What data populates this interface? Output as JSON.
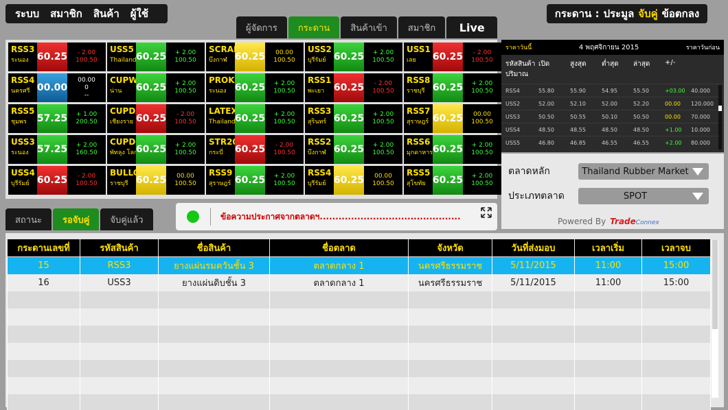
{
  "menu": [
    "ระบบ",
    "สมาชิก",
    "สินค้า",
    "ผู้ใช้"
  ],
  "tabs": [
    {
      "label": "ผู้จัดการ",
      "state": "normal"
    },
    {
      "label": "กระดาน",
      "state": "active"
    },
    {
      "label": "สินค้าเข้า",
      "state": "normal"
    },
    {
      "label": "สมาชิก",
      "state": "normal"
    },
    {
      "label": "Live",
      "state": "live"
    }
  ],
  "mode": {
    "board": "กระดาน :",
    "auction": "ประมูล",
    "match": "จับคู่",
    "contract": "ข้อตกลง"
  },
  "board": [
    {
      "code": "RSS3",
      "prov": "ระนอง",
      "price": "60.25",
      "c1": "- 2.00",
      "c2": "100.50",
      "trend": "dn"
    },
    {
      "code": "USS5",
      "prov": "Thailand",
      "price": "60.25",
      "c1": "+ 2.00",
      "c2": "100.50",
      "trend": "up"
    },
    {
      "code": "SCRAP",
      "prov": "บึงกาฬ",
      "price": "60.25",
      "c1": "00.00",
      "c2": "100.50",
      "trend": "eq"
    },
    {
      "code": "USS2",
      "prov": "บุรีรัมย์",
      "price": "60.25",
      "c1": "+ 2.00",
      "c2": "100.50",
      "trend": "up"
    },
    {
      "code": "USS1",
      "prov": "เลย",
      "price": "60.25",
      "c1": "- 2.00",
      "c2": "100.50",
      "trend": "dn"
    },
    {
      "code": "RSS4",
      "prov": "นครศรี",
      "price": "00.00",
      "c1": "00.00",
      "c2": "0",
      "c3": "--",
      "trend": "nt"
    },
    {
      "code": "CUPWET",
      "prov": "น่าน",
      "price": "60.25",
      "c1": "+ 2.00",
      "c2": "100.50",
      "trend": "up"
    },
    {
      "code": "PROK",
      "prov": "ระนอง",
      "price": "60.25",
      "c1": "+ 2.00",
      "c2": "100.50",
      "trend": "up"
    },
    {
      "code": "RSS1",
      "prov": "พะเยา",
      "price": "60.25",
      "c1": "- 2.00",
      "c2": "100.50",
      "trend": "dn"
    },
    {
      "code": "RSS8",
      "prov": "ราชบุรี",
      "price": "60.25",
      "c1": "+ 2.00",
      "c2": "100.50",
      "trend": "up"
    },
    {
      "code": "RSS5",
      "prov": "ชุมพร",
      "price": "57.25",
      "c1": "+ 1.00",
      "c2": "200.50",
      "trend": "up"
    },
    {
      "code": "CUPDAMP",
      "prov": "เชียงราย",
      "price": "60.25",
      "c1": "- 2.00",
      "c2": "100.50",
      "trend": "dn"
    },
    {
      "code": "LATEX",
      "prov": "Thailand",
      "price": "60.25",
      "c1": "+ 2.00",
      "c2": "100.50",
      "trend": "up"
    },
    {
      "code": "RSS3",
      "prov": "สุรินทร์",
      "price": "60.25",
      "c1": "+ 2.00",
      "c2": "100.50",
      "trend": "up"
    },
    {
      "code": "RSS7",
      "prov": "สุราษฎร์",
      "price": "60.25",
      "c1": "00.00",
      "c2": "100.50",
      "trend": "eq"
    },
    {
      "code": "USS3",
      "prov": "ระนอง",
      "price": "57.25",
      "c1": "+ 2.00",
      "c2": "160.50",
      "trend": "up"
    },
    {
      "code": "CUPDRY",
      "prov": "พัทลุง โลก",
      "price": "60.25",
      "c1": "+ 2.00",
      "c2": "100.50",
      "trend": "up"
    },
    {
      "code": "STR20",
      "prov": "กระบี่",
      "price": "60.25",
      "c1": "- 2.00",
      "c2": "100.50",
      "trend": "dn"
    },
    {
      "code": "RSS2",
      "prov": "บึงกาฬ",
      "price": "60.25",
      "c1": "+ 2.00",
      "c2": "100.50",
      "trend": "up"
    },
    {
      "code": "RSS6",
      "prov": "มุกดาหาร",
      "price": "60.25",
      "c1": "+ 2.00",
      "c2": "100.50",
      "trend": "up"
    },
    {
      "code": "USS4",
      "prov": "บุรีรัมย์",
      "price": "60.25",
      "c1": "- 2.00",
      "c2": "100.50",
      "trend": "dn"
    },
    {
      "code": "BULLOCK",
      "prov": "ราชบุรี",
      "price": "60.25",
      "c1": "00.00",
      "c2": "100.50",
      "trend": "eq"
    },
    {
      "code": "RSS9",
      "prov": "สุราษฎร์",
      "price": "60.25",
      "c1": "+ 2.00",
      "c2": "100.50",
      "trend": "up"
    },
    {
      "code": "RSS4",
      "prov": "บุรีรัมย์",
      "price": "60.25",
      "c1": "00.00",
      "c2": "100.50",
      "trend": "eq"
    },
    {
      "code": "RSS5",
      "prov": "สุโขทัย",
      "price": "60.25",
      "c1": "+ 2.00",
      "c2": "100.50",
      "trend": "up"
    }
  ],
  "prices": {
    "today_label": "ราคาวันนี้",
    "date": "4 พฤศจิกายน 2015",
    "prev_label": "ราคาวันก่อน",
    "cols": [
      "รหัสสินค้า",
      "เปิด",
      "สูงสุด",
      "ต่ำสุด",
      "ล่าสุด",
      "+/-",
      "ปริมาณ"
    ],
    "rows": [
      {
        "code": "RSS4",
        "open": "55.80",
        "high": "55.90",
        "low": "54.95",
        "last": "55.50",
        "chg": "+03.00",
        "vol": "40.000",
        "trend": "up"
      },
      {
        "code": "USS2",
        "open": "52.00",
        "high": "52.10",
        "low": "52.00",
        "last": "52.20",
        "chg": "00.00",
        "vol": "120.000",
        "trend": "eq"
      },
      {
        "code": "USS3",
        "open": "50.50",
        "high": "50.55",
        "low": "50.10",
        "last": "50.50",
        "chg": "00.00",
        "vol": "70.000",
        "trend": "eq"
      },
      {
        "code": "USS4",
        "open": "48.50",
        "high": "48.55",
        "low": "48.50",
        "last": "48.50",
        "chg": "+1.00",
        "vol": "10.000",
        "trend": "up"
      },
      {
        "code": "USS5",
        "open": "46.80",
        "high": "46.85",
        "low": "46.55",
        "last": "46.55",
        "chg": "+2.00",
        "vol": "80.000",
        "trend": "up"
      }
    ]
  },
  "filters": {
    "market_label": "ตลาดหลัก",
    "market_value": "Thailand Rubber Market",
    "type_label": "ประเภทตลาด",
    "type_value": "SPOT",
    "powered": "Powered By",
    "logo_a": "Trade",
    "logo_b": "Connex"
  },
  "status_tabs": [
    {
      "label": "สถานะ",
      "state": "normal"
    },
    {
      "label": "รอจับคู่",
      "state": "active"
    },
    {
      "label": "จับคู่แล้ว",
      "state": "normal"
    }
  ],
  "announcement": "ข้อความประกาศจากตลาดฯ.............................................",
  "table": {
    "headers": [
      "กระดานเลขที่",
      "รหัสสินค้า",
      "ชื่อสินค้า",
      "ชื่อตลาด",
      "จังหวัด",
      "วันที่ส่งมอบ",
      "เวลาเริ่ม",
      "เวลาจบ"
    ],
    "rows": [
      [
        "15",
        "RSS3",
        "ยางแผ่นรมควันชั้น 3",
        "ตลาดกลาง 1",
        "นครศรีธรรมราช",
        "5/11/2015",
        "11:00",
        "15:00"
      ],
      [
        "16",
        "USS3",
        "ยางแผ่นดิบชั้น 3",
        "ตลาดกลาง 1",
        "นครศรีธรรมราช",
        "5/11/2015",
        "11:00",
        "15:00"
      ]
    ],
    "selected_row": 0,
    "empty_rows": 7
  }
}
